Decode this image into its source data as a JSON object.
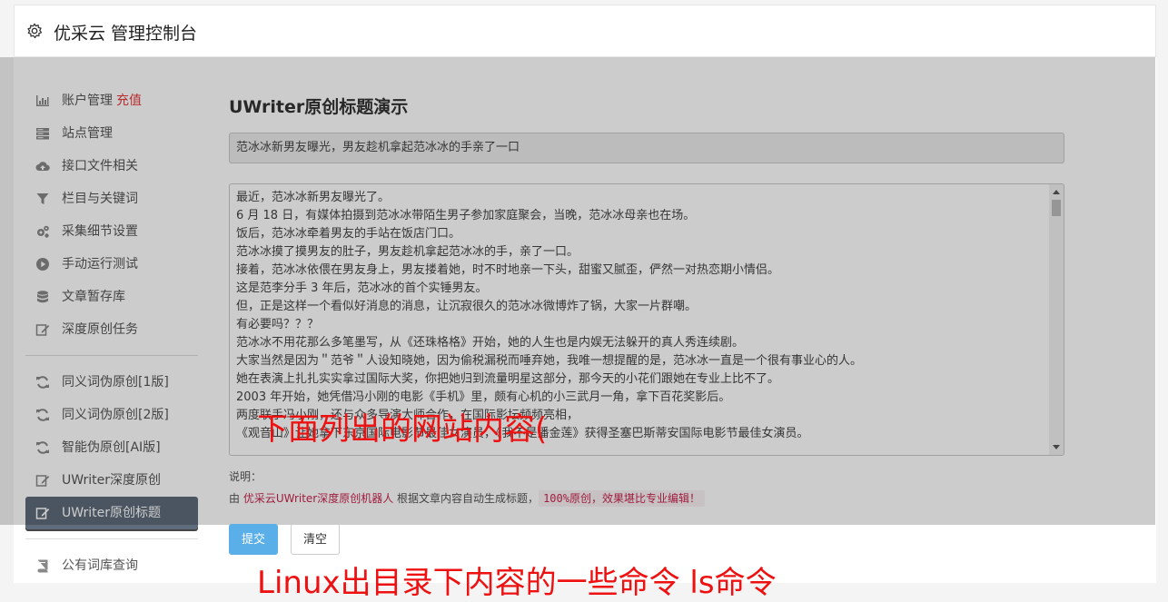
{
  "header": {
    "title": "优采云 管理控制台",
    "icon": "gear-icon"
  },
  "sidebar": {
    "items": [
      {
        "label": "账户管理",
        "badge": "充值",
        "icon": "bar-chart-icon"
      },
      {
        "label": "站点管理",
        "icon": "server-icon"
      },
      {
        "label": "接口文件相关",
        "icon": "cloud-upload-icon"
      },
      {
        "label": "栏目与关键词",
        "icon": "filter-icon"
      },
      {
        "label": "采集细节设置",
        "icon": "cogs-icon"
      },
      {
        "label": "手动运行测试",
        "icon": "play-circle-icon"
      },
      {
        "label": "文章暂存库",
        "icon": "database-icon"
      },
      {
        "label": "深度原创任务",
        "icon": "edit-icon"
      },
      {
        "label": "同义词伪原创[1版]",
        "icon": "refresh-icon"
      },
      {
        "label": "同义词伪原创[2版]",
        "icon": "refresh-icon"
      },
      {
        "label": "智能伪原创[AI版]",
        "icon": "refresh-icon"
      },
      {
        "label": "UWriter深度原创",
        "icon": "edit-icon"
      },
      {
        "label": "UWriter原创标题",
        "icon": "edit-icon",
        "active": true
      },
      {
        "label": "公有词库查询",
        "icon": "book-icon"
      }
    ]
  },
  "main": {
    "section_title": "UWriter原创标题演示",
    "title_value": "范冰冰新男友曝光，男友趁机拿起范冰冰的手亲了一口",
    "article_lines": [
      "最近，范冰冰新男友曝光了。",
      "6 月 18 日，有媒体拍摄到范冰冰带陌生男子参加家庭聚会，当晚，范冰冰母亲也在场。",
      "饭后，范冰冰牵着男友的手站在饭店门口。",
      "范冰冰摸了摸男友的肚子，男友趁机拿起范冰冰的手，亲了一口。",
      "接着，范冰冰依偎在男友身上，男友搂着她，时不时地亲一下头，甜蜜又腻歪，俨然一对热恋期小情侣。",
      "这是范李分手 3 年后，范冰冰的首个实锤男友。",
      "但，正是这样一个看似好消息的消息，让沉寂很久的范冰冰微博炸了锅，大家一片群嘲。",
      "有必要吗？？？",
      "范冰冰不用花那么多笔墨写，从《还珠格格》开始，她的人生也是内娱无法躲开的真人秀连续剧。",
      "大家当然是因为＂范爷＂人设知晓她，因为偷税漏税而唾弃她，我唯一想提醒的是，范冰冰一直是一个很有事业心的人。",
      "她在表演上扎扎实实拿过国际大奖，你把她归到流量明星这部分，那今天的小花们跟她在专业上比不了。",
      "2003 年开始，她凭借冯小刚的电影《手机》里，颇有心机的小三武月一角，拿下百花奖影后。",
      "两度联手冯小刚，还与众多导演大师合作，在国际影坛频频亮相，",
      "《观音山》让她拿下东京国际电影节最佳女演员，《我不是潘金莲》获得圣塞巴斯蒂安国际电影节最佳女演员。"
    ],
    "note_label": "说明：",
    "note_prefix": "由 ",
    "note_link": "优采云UWriter深度原创机器人",
    "note_mid": " 根据文章内容自动生成标题，",
    "note_code": "100%原创，效果堪比专业编辑！",
    "submit_label": "提交",
    "clear_label": "清空"
  },
  "overlay_texts": {
    "line1": "下面列出的网站内容(",
    "line2": "Linux出目录下内容的一些命令 ls命令"
  },
  "colors": {
    "accent": "#5aafe8",
    "active_nav": "#5e6b7a",
    "badge": "#e4393c",
    "overlay_text": "#ee1111"
  }
}
